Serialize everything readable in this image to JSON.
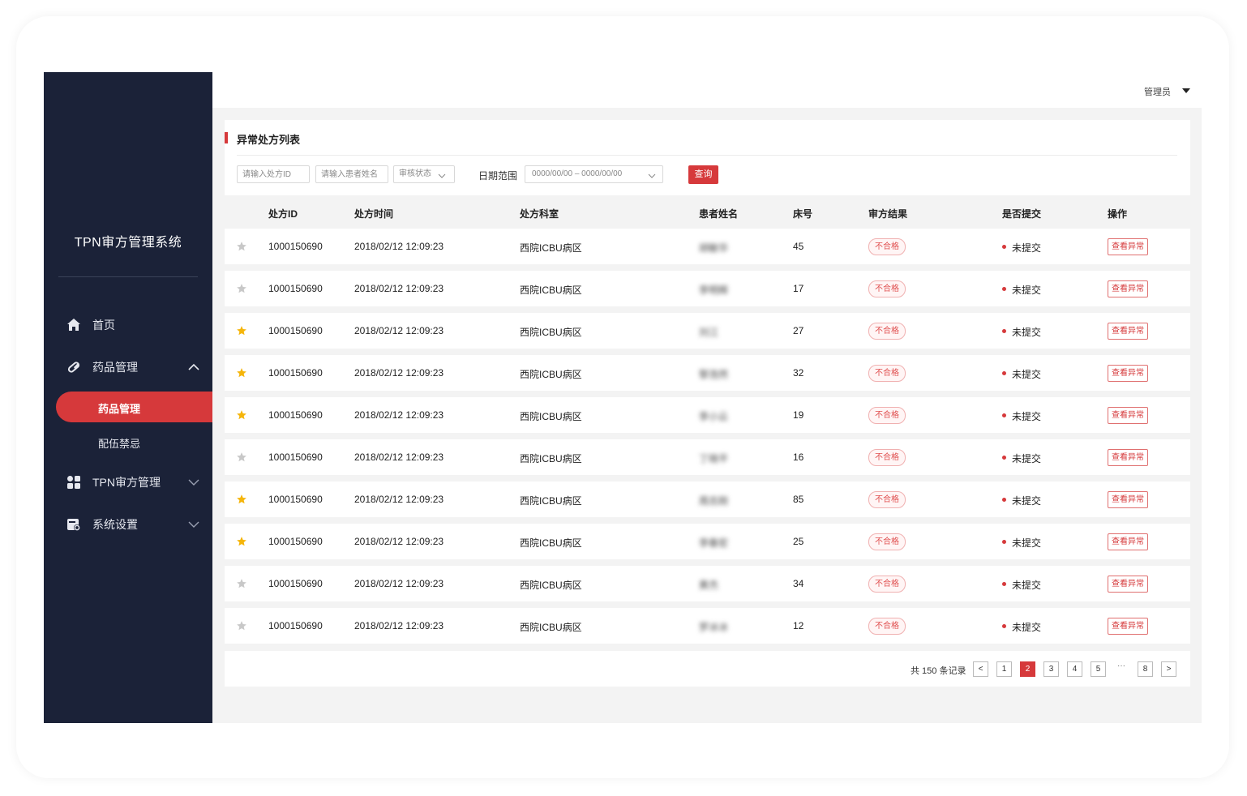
{
  "app": {
    "title": "TPN审方管理系统"
  },
  "sidebar": {
    "items": [
      {
        "label": "首页",
        "icon": "home-icon"
      },
      {
        "label": "药品管理",
        "icon": "pill-icon"
      },
      {
        "label": "TPN审方管理",
        "icon": "grid-icon"
      },
      {
        "label": "系统设置",
        "icon": "settings-icon"
      }
    ],
    "sub_items": [
      {
        "label": "药品管理",
        "active": true
      },
      {
        "label": "配伍禁忌",
        "active": false
      }
    ]
  },
  "header": {
    "user": "管理员"
  },
  "filters": {
    "title": "异常处方列表",
    "id_placeholder": "请输入处方ID",
    "name_placeholder": "请输入患者姓名",
    "status_select": "审核状态",
    "date_label": "日期范围",
    "date_value": "0000/00/00 – 0000/00/00",
    "query_label": "查询"
  },
  "table": {
    "columns": [
      "处方ID",
      "处方时间",
      "处方科室",
      "患者姓名",
      "床号",
      "审方结果",
      "是否提交",
      "操作"
    ],
    "rows": [
      {
        "starred": false,
        "id": "1000150690",
        "time": "2018/02/12 12:09:23",
        "dept": "西院ICBU病区",
        "name": "胡敏华",
        "bed": "45",
        "result": "不合格",
        "submit": "未提交",
        "action": "查看异常"
      },
      {
        "starred": false,
        "id": "1000150690",
        "time": "2018/02/12 12:09:23",
        "dept": "西院ICBU病区",
        "name": "李明辉",
        "bed": "17",
        "result": "不合格",
        "submit": "未提交",
        "action": "查看异常"
      },
      {
        "starred": true,
        "id": "1000150690",
        "time": "2018/02/12 12:09:23",
        "dept": "西院ICBU病区",
        "name": "刘江",
        "bed": "27",
        "result": "不合格",
        "submit": "未提交",
        "action": "查看异常"
      },
      {
        "starred": true,
        "id": "1000150690",
        "time": "2018/02/12 12:09:23",
        "dept": "西院ICBU病区",
        "name": "黎浩然",
        "bed": "32",
        "result": "不合格",
        "submit": "未提交",
        "action": "查看异常"
      },
      {
        "starred": true,
        "id": "1000150690",
        "time": "2018/02/12 12:09:23",
        "dept": "西院ICBU病区",
        "name": "李小云",
        "bed": "19",
        "result": "不合格",
        "submit": "未提交",
        "action": "查看异常"
      },
      {
        "starred": false,
        "id": "1000150690",
        "time": "2018/02/12 12:09:23",
        "dept": "西院ICBU病区",
        "name": "丁晓平",
        "bed": "16",
        "result": "不合格",
        "submit": "未提交",
        "action": "查看异常"
      },
      {
        "starred": true,
        "id": "1000150690",
        "time": "2018/02/12 12:09:23",
        "dept": "西院ICBU病区",
        "name": "周志刚",
        "bed": "85",
        "result": "不合格",
        "submit": "未提交",
        "action": "查看异常"
      },
      {
        "starred": true,
        "id": "1000150690",
        "time": "2018/02/12 12:09:23",
        "dept": "西院ICBU病区",
        "name": "李春宏",
        "bed": "25",
        "result": "不合格",
        "submit": "未提交",
        "action": "查看异常"
      },
      {
        "starred": false,
        "id": "1000150690",
        "time": "2018/02/12 12:09:23",
        "dept": "西院ICBU病区",
        "name": "黄杰",
        "bed": "34",
        "result": "不合格",
        "submit": "未提交",
        "action": "查看异常"
      },
      {
        "starred": false,
        "id": "1000150690",
        "time": "2018/02/12 12:09:23",
        "dept": "西院ICBU病区",
        "name": "罗冰冰",
        "bed": "12",
        "result": "不合格",
        "submit": "未提交",
        "action": "查看异常"
      }
    ]
  },
  "pagination": {
    "total_text": "共 150 条记录",
    "prev": "<",
    "next": ">",
    "pages": [
      "1",
      "2",
      "3",
      "4",
      "5"
    ],
    "ellipsis": "···",
    "last": "8",
    "current": "2"
  },
  "colors": {
    "accent": "#d6393b",
    "sidebar": "#1b2238",
    "star_on": "#f5b50a",
    "star_off": "#c8c8c8"
  }
}
